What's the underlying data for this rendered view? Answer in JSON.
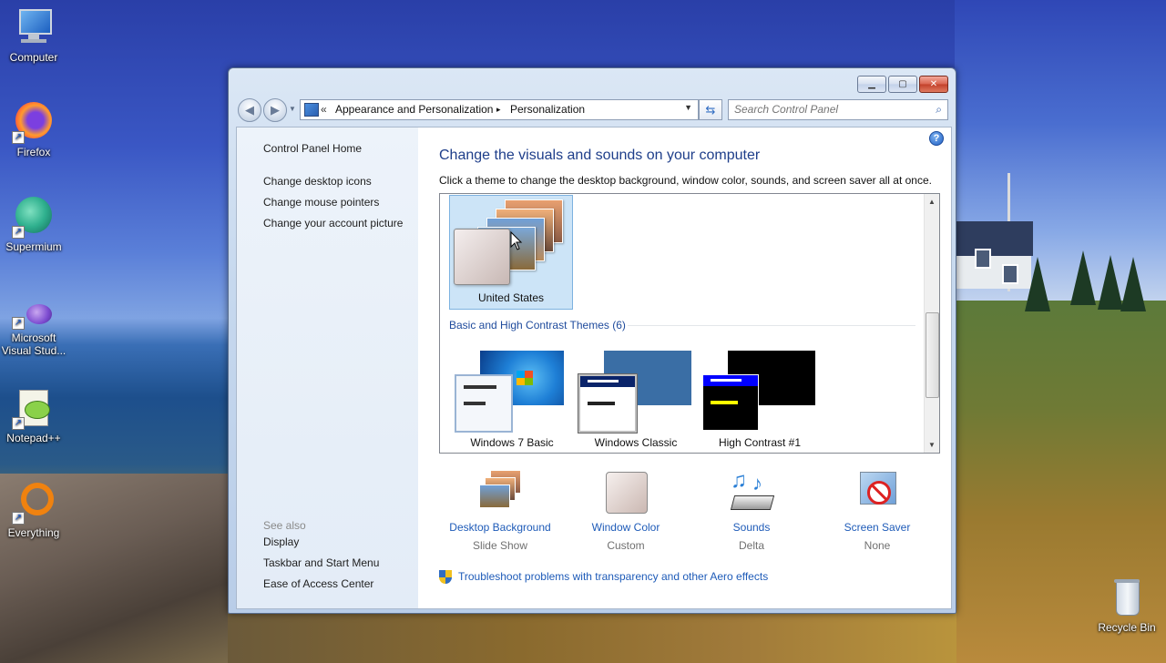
{
  "desktop": {
    "icons": [
      {
        "label": "Computer",
        "icon": "computer-icon"
      },
      {
        "label": "Firefox",
        "icon": "firefox-icon"
      },
      {
        "label": "Supermium",
        "icon": "supermium-icon"
      },
      {
        "label": "Microsoft Visual Stud...",
        "icon": "visual-studio-icon"
      },
      {
        "label": "Notepad++",
        "icon": "notepad-plus-icon"
      },
      {
        "label": "Everything",
        "icon": "everything-icon"
      },
      {
        "label": "Recycle Bin",
        "icon": "recycle-bin-icon"
      }
    ]
  },
  "window": {
    "controls": {
      "minimize": "minimize-icon",
      "maximize": "maximize-icon",
      "close": "close-icon"
    },
    "address": {
      "prefix": "«",
      "crumbs": [
        "Appearance and Personalization",
        "Personalization"
      ],
      "separator": "▸"
    },
    "search": {
      "placeholder": "Search Control Panel"
    },
    "left_pane": {
      "links": [
        "Control Panel Home",
        "Change desktop icons",
        "Change mouse pointers",
        "Change your account picture"
      ],
      "see_also_label": "See also",
      "see_also_links": [
        "Display",
        "Taskbar and Start Menu",
        "Ease of Access Center"
      ]
    },
    "main": {
      "title": "Change the visuals and sounds on your computer",
      "subtitle": "Click a theme to change the desktop background, window color, sounds, and screen saver all at once.",
      "selected_theme": {
        "label": "United States"
      },
      "group_title": "Basic and High Contrast Themes (6)",
      "themes": [
        {
          "label": "Windows 7 Basic"
        },
        {
          "label": "Windows Classic"
        },
        {
          "label": "High Contrast #1"
        }
      ],
      "bottom_items": [
        {
          "label": "Desktop Background",
          "sub": "Slide Show",
          "icon": "desktop-background-icon"
        },
        {
          "label": "Window Color",
          "sub": "Custom",
          "icon": "window-color-icon"
        },
        {
          "label": "Sounds",
          "sub": "Delta",
          "icon": "sounds-icon"
        },
        {
          "label": "Screen Saver",
          "sub": "None",
          "icon": "screen-saver-icon"
        }
      ],
      "troubleshoot_link": "Troubleshoot problems with transparency and other Aero effects"
    },
    "colors": {
      "link": "#1e5bb8",
      "title": "#1e3e8a",
      "selection": "#cce4f7"
    }
  }
}
